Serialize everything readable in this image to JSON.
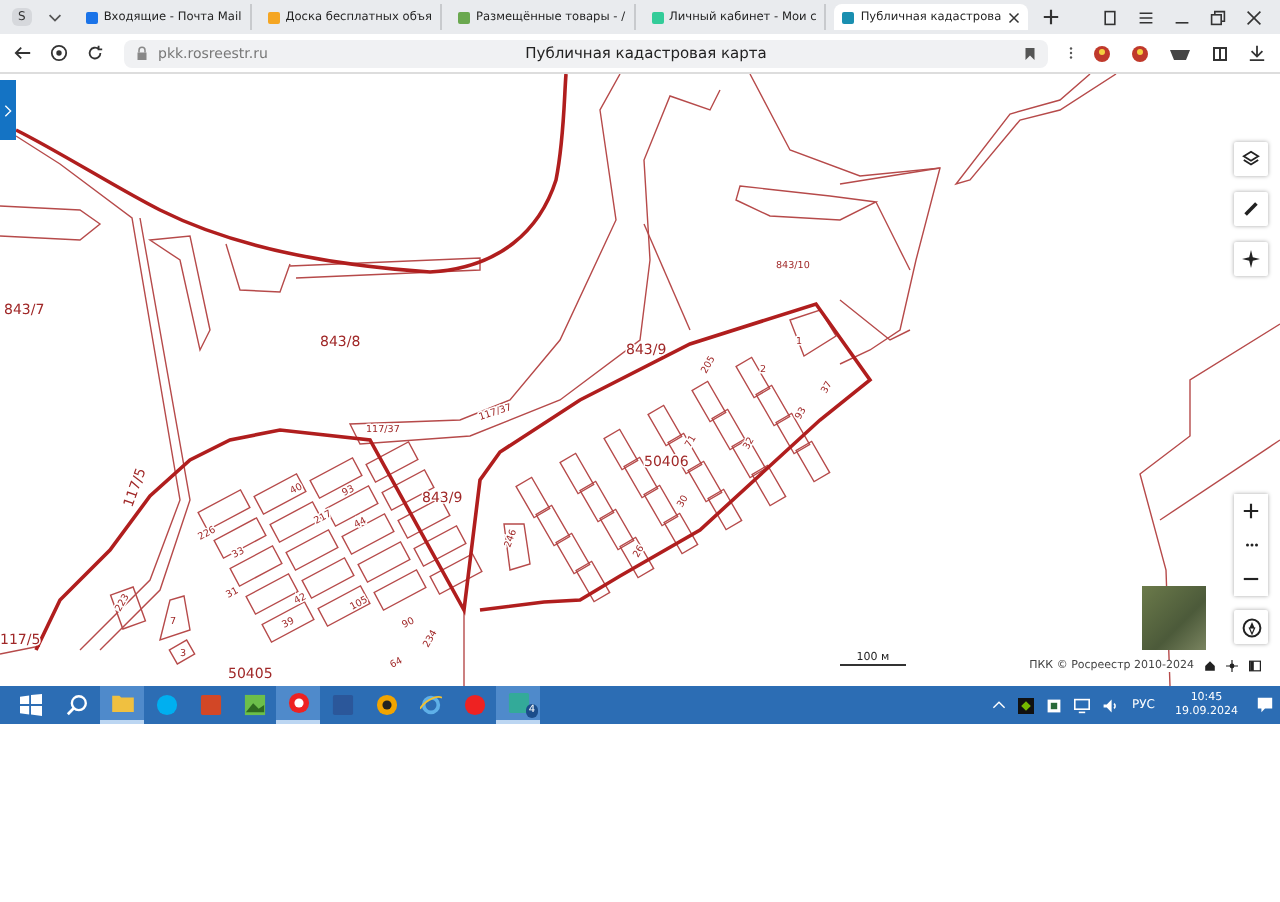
{
  "browser": {
    "profile": "S",
    "tabs": [
      {
        "title": "Входящие - Почта Mail",
        "kind": "mail",
        "selected": false
      },
      {
        "title": "Доска бесплатных объя",
        "kind": "board",
        "selected": false
      },
      {
        "title": "Размещённые товары - /",
        "kind": "goods",
        "selected": false
      },
      {
        "title": "Личный кабинет - Мои с",
        "kind": "cabinet",
        "selected": false
      },
      {
        "title": "Публичная кадастрова",
        "kind": "cadastre",
        "selected": true
      }
    ],
    "address": "pkk.rosreestr.ru",
    "page_title": "Публичная кадастровая карта"
  },
  "map": {
    "parcel_labels": [
      "843/7",
      "843/10",
      "843/8",
      "843/9",
      "2",
      "1",
      "117/37",
      "117/37",
      "843/9",
      "50406",
      "117/5",
      "117/5",
      "40",
      "93",
      "217",
      "44",
      "226",
      "33",
      "31",
      "39",
      "42",
      "105",
      "90",
      "234",
      "64",
      "223",
      "7",
      "3",
      "50405",
      "246",
      "37",
      "93",
      "32",
      "205",
      "71",
      "30",
      "26"
    ],
    "scale_label": "100 м",
    "attribution": "ПКК © Росреестр 2010-2024"
  },
  "taskbar": {
    "apps": [
      {
        "kind": "explorer",
        "active": true
      },
      {
        "kind": "skype",
        "active": false
      },
      {
        "kind": "slides",
        "active": false
      },
      {
        "kind": "photos",
        "active": false
      },
      {
        "kind": "browser",
        "active": true
      },
      {
        "kind": "word",
        "active": false
      },
      {
        "kind": "player",
        "active": false
      },
      {
        "kind": "ie",
        "active": false
      },
      {
        "kind": "yandex",
        "active": false
      },
      {
        "kind": "app",
        "active": true,
        "badge": "4"
      }
    ],
    "language": "РУС",
    "time": "10:45",
    "date": "19.09.2024"
  }
}
